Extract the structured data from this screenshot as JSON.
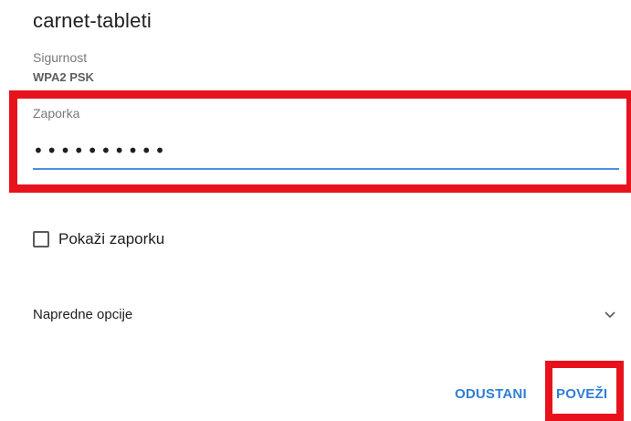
{
  "dialog": {
    "title": "carnet-tableti"
  },
  "security": {
    "label": "Sigurnost",
    "value": "WPA2 PSK"
  },
  "password": {
    "label": "Zaporka",
    "value": "••••••••••"
  },
  "show_password": {
    "label": "Pokaži zaporku",
    "checked": false
  },
  "advanced": {
    "label": "Napredne opcije",
    "icon": "chevron-down-icon"
  },
  "actions": {
    "cancel_label": "ODUSTANI",
    "connect_label": "POVEŽI"
  },
  "colors": {
    "accent": "#2f7fd6",
    "input_underline": "#4a90e2",
    "highlight": "#e8121d"
  }
}
